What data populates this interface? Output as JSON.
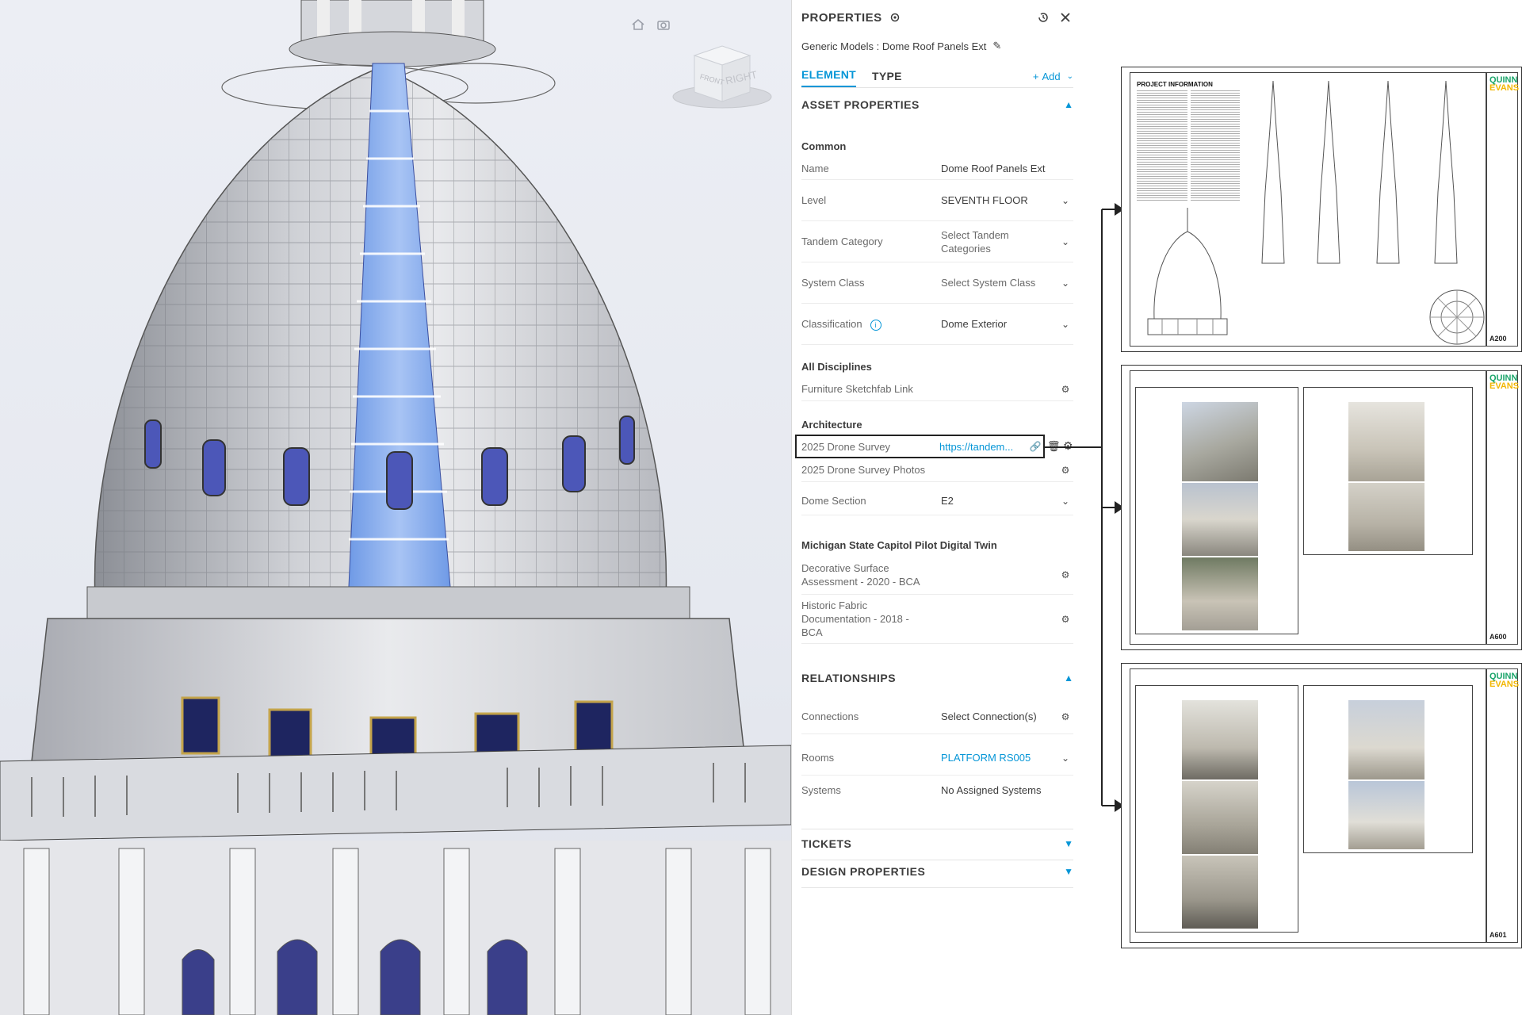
{
  "panel": {
    "title": "PROPERTIES",
    "subtitle": "Generic Models : Dome Roof Panels Ext",
    "tabs": [
      {
        "label": "ELEMENT",
        "active": true
      },
      {
        "label": "TYPE",
        "active": false
      }
    ],
    "add_label": "Add",
    "sections": {
      "asset": "ASSET PROPERTIES",
      "relationships": "RELATIONSHIPS",
      "tickets": "TICKETS",
      "design": "DESIGN PROPERTIES"
    },
    "common": {
      "group": "Common",
      "rows": [
        {
          "label": "Name",
          "value": "Dome Roof Panels Ext"
        },
        {
          "label": "Level",
          "value": "SEVENTH FLOOR"
        },
        {
          "label": "Tandem Category",
          "value": "Select Tandem Categories"
        },
        {
          "label": "System Class",
          "value": "Select System Class"
        },
        {
          "label": "Classification",
          "value": "Dome Exterior"
        }
      ]
    },
    "all_disciplines": {
      "group": "All Disciplines",
      "rows": [
        {
          "label": "Furniture Sketchfab Link",
          "value": ""
        }
      ]
    },
    "architecture": {
      "group": "Architecture",
      "rows": [
        {
          "label": "2025 Drone Survey",
          "value": "https://tandem..."
        },
        {
          "label": "2025 Drone Survey Photos",
          "value": ""
        },
        {
          "label": "Dome Section",
          "value": "E2"
        }
      ]
    },
    "michigan": {
      "group": "Michigan State Capitol Pilot Digital Twin",
      "rows": [
        {
          "label": "Decorative Surface Assessment - 2020 - BCA",
          "value": ""
        },
        {
          "label": "Historic Fabric Documentation - 2018 - BCA",
          "value": ""
        }
      ]
    },
    "relationships": {
      "rows": [
        {
          "label": "Connections",
          "value": "Select Connection(s)"
        },
        {
          "label": "Rooms",
          "value": "PLATFORM RS005"
        },
        {
          "label": "Systems",
          "value": "No Assigned Systems"
        }
      ]
    }
  },
  "viewcube": {
    "front": "FRONT",
    "right": "RIGHT"
  },
  "sheets": [
    {
      "logo_line1": "QUINN",
      "logo_line2": "EVANS",
      "number": "A200",
      "heading": "PROJECT INFORMATION"
    },
    {
      "logo_line1": "QUINN",
      "logo_line2": "EVANS",
      "number": "A600"
    },
    {
      "logo_line1": "QUINN",
      "logo_line2": "EVANS",
      "number": "A601"
    }
  ],
  "colors": {
    "accent": "#0696d7",
    "glass": "#7fa8e8",
    "logo_green": "#1aa56a",
    "logo_yellow": "#f2b600"
  }
}
